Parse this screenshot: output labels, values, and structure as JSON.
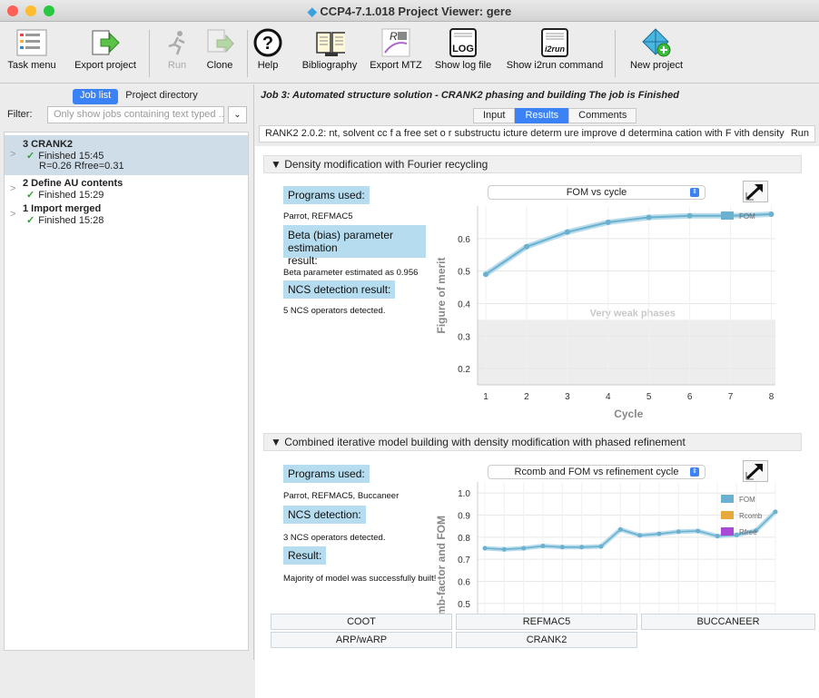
{
  "window": {
    "title": "CCP4-7.1.018 Project Viewer: gere"
  },
  "toolbar": {
    "items": [
      {
        "label": "Task menu",
        "icon": "task-menu-icon"
      },
      {
        "label": "Export project",
        "icon": "export-arrow-icon"
      },
      {
        "label": "Run",
        "icon": "run-icon"
      },
      {
        "label": "Clone",
        "icon": "clone-icon"
      },
      {
        "label": "Help",
        "icon": "help-icon"
      },
      {
        "label": "Bibliography",
        "icon": "book-icon"
      },
      {
        "label": "Export MTZ",
        "icon": "mtz-icon"
      },
      {
        "label": "Show log file",
        "icon": "log-icon"
      },
      {
        "label": "Show i2run command",
        "icon": "i2run-icon"
      },
      {
        "label": "New project",
        "icon": "new-project-icon"
      }
    ],
    "log_glyph": "LOG",
    "i2run_glyph": "i2run"
  },
  "left": {
    "tabs": [
      "Job list",
      "Project directory"
    ],
    "filter_label": "Filter:",
    "filter_placeholder": "Only show jobs containing text typed ...",
    "jobs": [
      {
        "name": "3 CRANK2",
        "status": "Finished 15:45",
        "extra": "R=0.26 Rfree=0.31"
      },
      {
        "name": "2 Define AU contents",
        "status": "Finished 15:29"
      },
      {
        "name": "1 Import merged",
        "status": "Finished 15:28"
      }
    ]
  },
  "right": {
    "job_title": "Job 3:  Automated structure solution - CRANK2 phasing and building   The job is Finished",
    "tabs": [
      "Input",
      "Results",
      "Comments"
    ],
    "message": "RANK2 2.0.2: nt, solvent cc f a free set o  r substructu  icture determ  ure improve  d determina  cation with F  vith density r",
    "run_label": "Run"
  },
  "section1": {
    "heading": "▼ Density modification with Fourier recycling",
    "programs_label": "Programs used:",
    "programs": "Parrot, REFMAC5",
    "beta_label_1": "Beta (bias) parameter estimation",
    "beta_label_2": "result:",
    "beta_text": "Beta parameter estimated as 0.956",
    "ncs_label": "NCS detection result:",
    "ncs_text": "5 NCS operators detected.",
    "graph_select": "FOM vs cycle"
  },
  "section2": {
    "heading": "▼ Combined iterative model building with density modification with phased refinement",
    "programs_label": "Programs used:",
    "programs": "Parrot, REFMAC5, Buccaneer",
    "ncs_label": "NCS detection:",
    "ncs_text": "3 NCS operators detected.",
    "result_label": "Result:",
    "result_text": "Majority of model was successfully built!",
    "graph_select": "Rcomb and FOM vs refinement cycle"
  },
  "buttons": [
    "COOT",
    "REFMAC5",
    "BUCCANEER",
    "ARP/wARP",
    "CRANK2"
  ],
  "chart_data": [
    {
      "type": "line",
      "title": "",
      "xlabel": "Cycle",
      "ylabel": "Figure of merit",
      "x": [
        1,
        2,
        3,
        4,
        5,
        6,
        7,
        8
      ],
      "series": [
        {
          "name": "FOM",
          "values": [
            0.49,
            0.575,
            0.62,
            0.65,
            0.665,
            0.67,
            0.67,
            0.675
          ],
          "color": "#6ab0cf"
        }
      ],
      "xlim": [
        0.8,
        8.1
      ],
      "ylim": [
        0.15,
        0.7
      ],
      "yticks": [
        0.2,
        0.3,
        0.4,
        0.5,
        0.6
      ],
      "xticks": [
        1,
        2,
        3,
        4,
        5,
        6,
        7,
        8
      ],
      "shaded_region": {
        "label": "Very weak phases",
        "from": 0.15,
        "to": 0.35
      },
      "legend": "top-right"
    },
    {
      "type": "line",
      "title": "",
      "ylabel": "mb-factor and FOM",
      "x": [
        1,
        2,
        3,
        4,
        5,
        6,
        7,
        8,
        9,
        10,
        11,
        12,
        13,
        14,
        15,
        16
      ],
      "series": [
        {
          "name": "FOM",
          "values": [
            0.75,
            0.745,
            0.75,
            0.76,
            0.755,
            0.755,
            0.758,
            0.835,
            0.808,
            0.815,
            0.825,
            0.828,
            0.805,
            0.81,
            0.83,
            0.915
          ],
          "color": "#6ab0cf"
        },
        {
          "name": "Rcomb",
          "values": [],
          "color": "#e8a93b"
        },
        {
          "name": "Rfree",
          "values": [],
          "color": "#a84ad6"
        }
      ],
      "ylim": [
        0.45,
        1.05
      ],
      "yticks": [
        0.5,
        0.6,
        0.7,
        0.8,
        0.9,
        1.0
      ],
      "legend": "top-right"
    }
  ]
}
